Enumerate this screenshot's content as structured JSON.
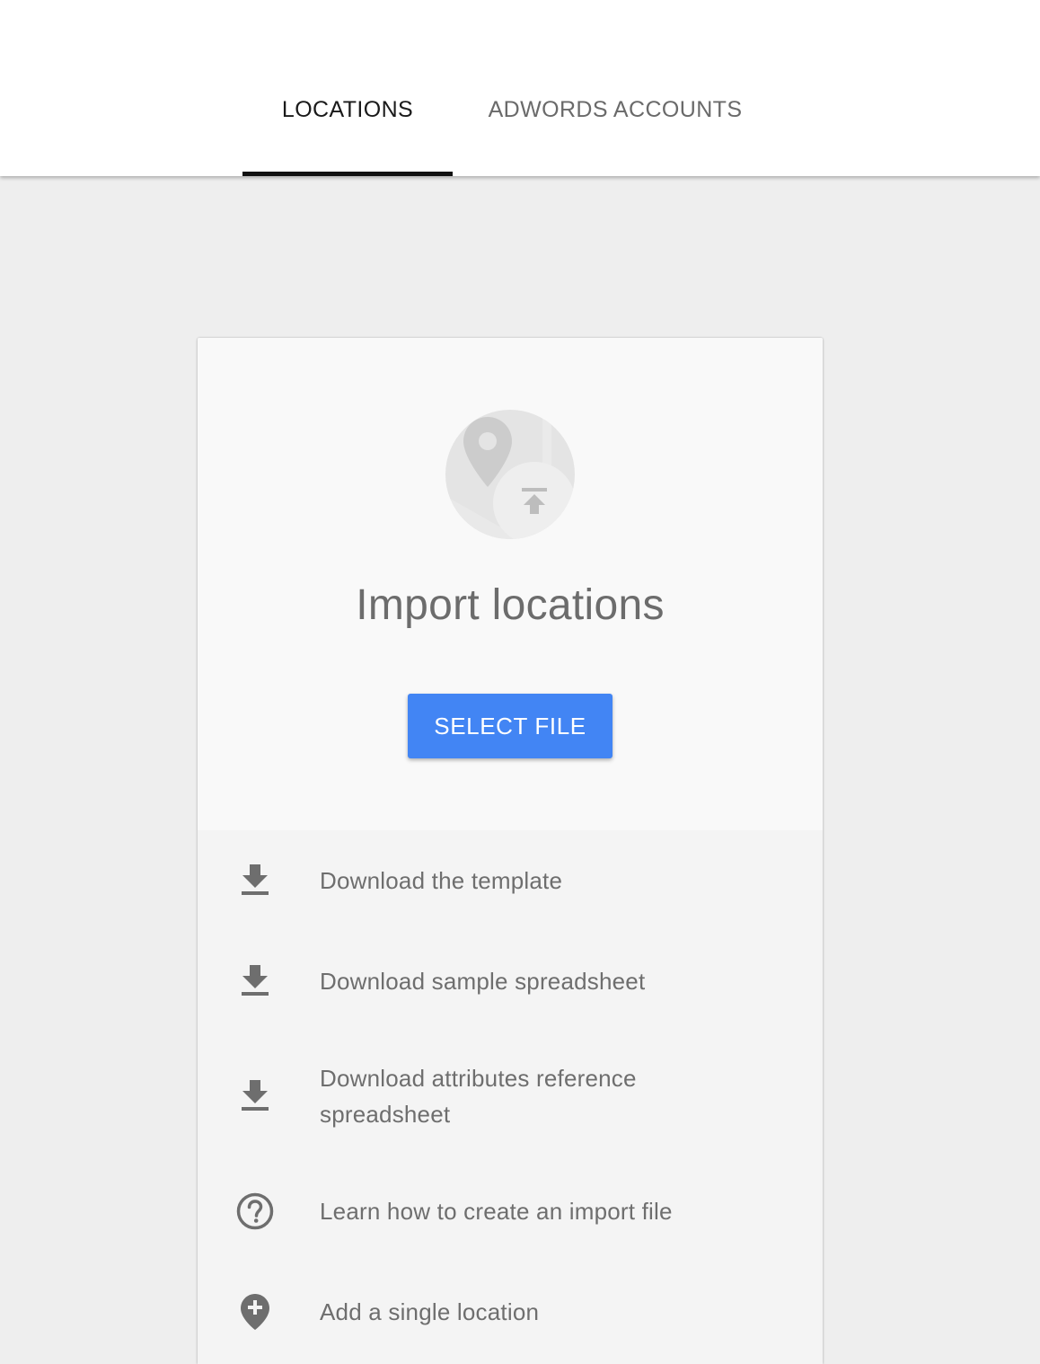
{
  "tabs": [
    {
      "label": "LOCATIONS",
      "active": true
    },
    {
      "label": "ADWORDS ACCOUNTS",
      "active": false
    }
  ],
  "card": {
    "title": "Import locations",
    "select_button_label": "SELECT FILE",
    "hero_icon": "map-upload-icon"
  },
  "links": [
    {
      "label": "Download the template",
      "icon": "download-icon"
    },
    {
      "label": "Download sample spreadsheet",
      "icon": "download-icon"
    },
    {
      "label": "Download attributes reference spreadsheet",
      "icon": "download-icon"
    },
    {
      "label": "Learn how to create an import file",
      "icon": "help-circle-icon"
    },
    {
      "label": "Add a single location",
      "icon": "add-location-icon"
    }
  ],
  "colors": {
    "accent": "#4285f4",
    "background": "#eeeeee",
    "text_secondary": "#6e6e6e",
    "tab_indicator": "#111111"
  }
}
